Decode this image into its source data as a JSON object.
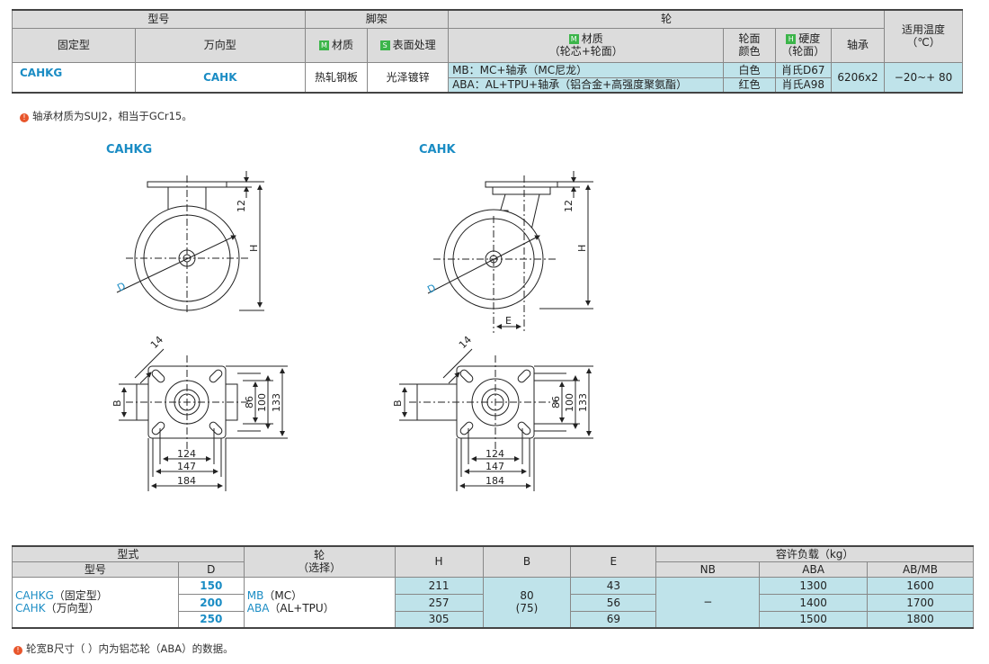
{
  "spec_table": {
    "h_model": "型号",
    "h_bracket": "脚架",
    "h_wheel": "轮",
    "h_temp": "适用温度",
    "h_temp_unit": "（℃）",
    "h_fixed": "固定型",
    "h_swivel": "万向型",
    "h_bracket_material": "材质",
    "h_surface": "表面处理",
    "h_wheel_material": "材质",
    "h_wheel_material_sub": "（轮芯+轮面）",
    "h_tread_color_1": "轮面",
    "h_tread_color_2": "颜色",
    "h_hardness": "硬度",
    "h_hardness_sub": "（轮面）",
    "h_bearing": "轴承",
    "badge_m": "M",
    "badge_s": "S",
    "badge_h": "H",
    "fixed_model": "CAHKG",
    "swivel_model": "CAHK",
    "bracket_material": "热轧钢板",
    "surface": "光泽镀锌",
    "wheel_mb": "MB：MC+轴承（MC尼龙）",
    "wheel_aba": "ABA：AL+TPU+轴承（铝合金+高强度聚氨酯）",
    "color_mb": "白色",
    "color_aba": "红色",
    "hard_mb": "肖氏D67",
    "hard_aba": "肖氏A98",
    "bearing": "6206x2",
    "temp": "−20~+ 80"
  },
  "note1": "轴承材质为SUJ2，相当于GCr15。",
  "note_mark": "!",
  "drawings": {
    "label_fixed": "CAHKG",
    "label_swivel": "CAHK",
    "dim_12": "12",
    "dim_H": "H",
    "dim_D": "D",
    "dim_E": "E",
    "dim_14": "14",
    "dim_B": "B",
    "dim_86": "86",
    "dim_100": "100",
    "dim_133": "133",
    "dim_124": "124",
    "dim_147": "147",
    "dim_184": "184"
  },
  "dim_table": {
    "h_type": "型式",
    "h_model": "型号",
    "h_D": "D",
    "h_wheel": "轮",
    "h_wheel_sub": "（选择）",
    "h_H": "H",
    "h_B": "B",
    "h_E": "E",
    "h_load": "容许负载（kg）",
    "h_NB": "NB",
    "h_ABA": "ABA",
    "h_ABMB": "AB/MB",
    "model_fixed": "CAHKG",
    "model_fixed_suffix": "（固定型）",
    "model_swivel": "CAHK",
    "model_swivel_suffix": "（万向型）",
    "wheel_mb": "MB",
    "wheel_mb_suffix": "（MC）",
    "wheel_aba": "ABA",
    "wheel_aba_suffix": "（AL+TPU）",
    "B_value": "80",
    "B_sub": "(75)",
    "NB_value": "−",
    "rows": [
      {
        "D": "150",
        "H": "211",
        "E": "43",
        "ABA": "1300",
        "ABMB": "1600"
      },
      {
        "D": "200",
        "H": "257",
        "E": "56",
        "ABA": "1400",
        "ABMB": "1700"
      },
      {
        "D": "250",
        "H": "305",
        "E": "69",
        "ABA": "1500",
        "ABMB": "1800"
      }
    ]
  },
  "note2": "轮宽B尺寸（ ）内为铝芯轮（ABA）的数据。"
}
